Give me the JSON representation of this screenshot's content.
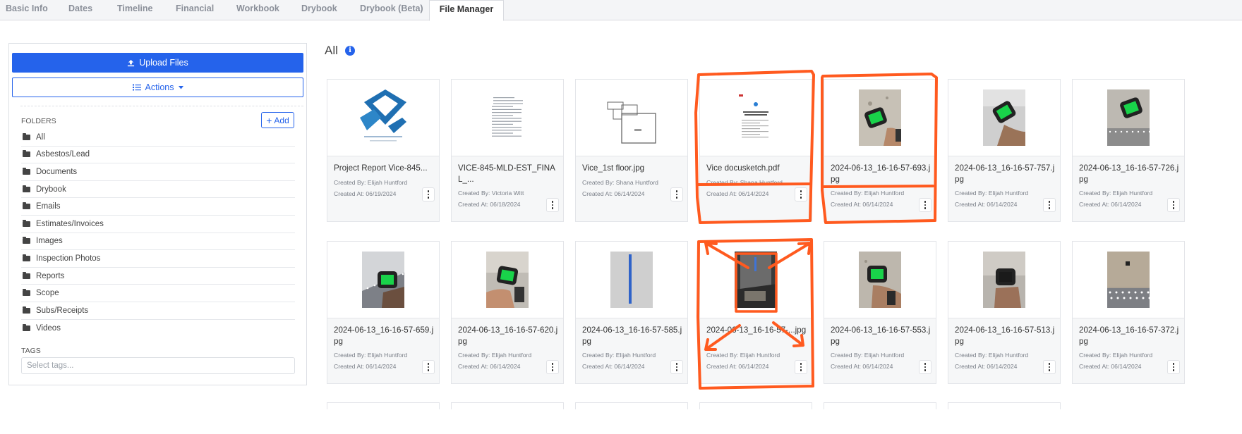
{
  "tabs": [
    {
      "label": "Basic Info",
      "active": false
    },
    {
      "label": "Dates",
      "active": false
    },
    {
      "label": "Timeline",
      "active": false
    },
    {
      "label": "Financial",
      "active": false
    },
    {
      "label": "Workbook",
      "active": false
    },
    {
      "label": "Drybook",
      "active": false
    },
    {
      "label": "Drybook (Beta)",
      "active": false
    },
    {
      "label": "File Manager",
      "active": true
    }
  ],
  "sidebar": {
    "upload_label": "Upload Files",
    "actions_label": "Actions",
    "folders_label": "FOLDERS",
    "add_label": "Add",
    "folders": [
      "All",
      "Asbestos/Lead",
      "Documents",
      "Drybook",
      "Emails",
      "Estimates/Invoices",
      "Images",
      "Inspection Photos",
      "Reports",
      "Scope",
      "Subs/Receipts",
      "Videos"
    ],
    "tags_label": "TAGS",
    "tags_placeholder": "Select tags..."
  },
  "main": {
    "title": "All",
    "files": [
      {
        "name": "Project Report Vice-845...",
        "created_by": "Created By: Elijah Huntford",
        "created_at": "Created At: 06/19/2024",
        "thumb": "report"
      },
      {
        "name": "VICE-845-MLD-EST_FINAL_...",
        "created_by": "Created By: Victoria Witt",
        "created_at": "Created At: 06/18/2024",
        "thumb": "document"
      },
      {
        "name": "Vice_1st floor.jpg",
        "created_by": "Created By: Shana Huntford",
        "created_at": "Created At: 06/14/2024",
        "thumb": "floorplan"
      },
      {
        "name": "Vice docusketch.pdf",
        "created_by": "Created By: Shana Huntford",
        "created_at": "Created At: 06/14/2024",
        "thumb": "document2"
      },
      {
        "name": "2024-06-13_16-16-57-693.jpg",
        "created_by": "Created By: Elijah Huntford",
        "created_at": "Created At: 06/14/2024",
        "thumb": "meter-wall"
      },
      {
        "name": "2024-06-13_16-16-57-757.jpg",
        "created_by": "Created By: Elijah Huntford",
        "created_at": "Created At: 06/14/2024",
        "thumb": "meter-green"
      },
      {
        "name": "2024-06-13_16-16-57-726.jpg",
        "created_by": "Created By: Elijah Huntford",
        "created_at": "Created At: 06/14/2024",
        "thumb": "meter-green2"
      },
      {
        "name": "2024-06-13_16-16-57-659.jpg",
        "created_by": "Created By: Elijah Huntford",
        "created_at": "Created At: 06/14/2024",
        "thumb": "meter-ceiling"
      },
      {
        "name": "2024-06-13_16-16-57-620.jpg",
        "created_by": "Created By: Elijah Huntford",
        "created_at": "Created At: 06/14/2024",
        "thumb": "meter-hand"
      },
      {
        "name": "2024-06-13_16-16-57-585.jpg",
        "created_by": "Created By: Elijah Huntford",
        "created_at": "Created At: 06/14/2024",
        "thumb": "wall-blue"
      },
      {
        "name": "2024-06-13_16-16-57-...jpg",
        "created_by": "Created By: Elijah Huntford",
        "created_at": "Created At: 06/14/2024",
        "thumb": "dark-room"
      },
      {
        "name": "2024-06-13_16-16-57-553.jpg",
        "created_by": "Created By: Elijah Huntford",
        "created_at": "Created At: 06/14/2024",
        "thumb": "meter-wall2"
      },
      {
        "name": "2024-06-13_16-16-57-513.jpg",
        "created_by": "Created By: Elijah Huntford",
        "created_at": "Created At: 06/14/2024",
        "thumb": "meter-dark"
      },
      {
        "name": "2024-06-13_16-16-57-372.jpg",
        "created_by": "Created By: Elijah Huntford",
        "created_at": "Created At: 06/14/2024",
        "thumb": "ceiling-lights"
      }
    ]
  },
  "colors": {
    "primary": "#2563eb",
    "annotation": "#ff5a1f",
    "meter_screen": "#19d34a"
  }
}
